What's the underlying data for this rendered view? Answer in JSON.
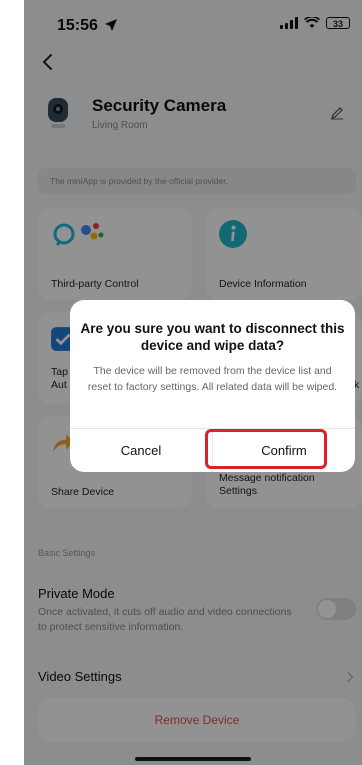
{
  "status_bar": {
    "time": "15:56",
    "battery": "33"
  },
  "device": {
    "name": "Security Camera",
    "room": "Living Room"
  },
  "provider_note": "The miniApp is provided by the official provider.",
  "tiles": [
    {
      "label": "Third-party Control"
    },
    {
      "label": "Device Information"
    },
    {
      "label": "Tap"
    },
    {
      "label": "Aut"
    },
    {
      "label": "k"
    },
    {
      "label": "Share Device"
    },
    {
      "label": "Message notification Settings"
    }
  ],
  "basic_settings": {
    "section_label": "Basic Settings",
    "private_mode": {
      "title": "Private Mode",
      "description": "Once activated, it cuts off audio and video connections to protect sensitive information.",
      "enabled": false
    },
    "video_settings": {
      "title": "Video Settings"
    }
  },
  "remove_button": "Remove Device",
  "dialog": {
    "title": "Are you sure you want to disconnect this device and wipe data?",
    "message": "The device will be removed from the device list and reset to factory settings. All related data will be wiped.",
    "cancel": "Cancel",
    "confirm": "Confirm"
  },
  "colors": {
    "danger_text": "#e24a4a",
    "highlight_border": "#d8232a",
    "info_icon": "#1fb5c9",
    "checkbox_icon": "#1f7bd8"
  }
}
